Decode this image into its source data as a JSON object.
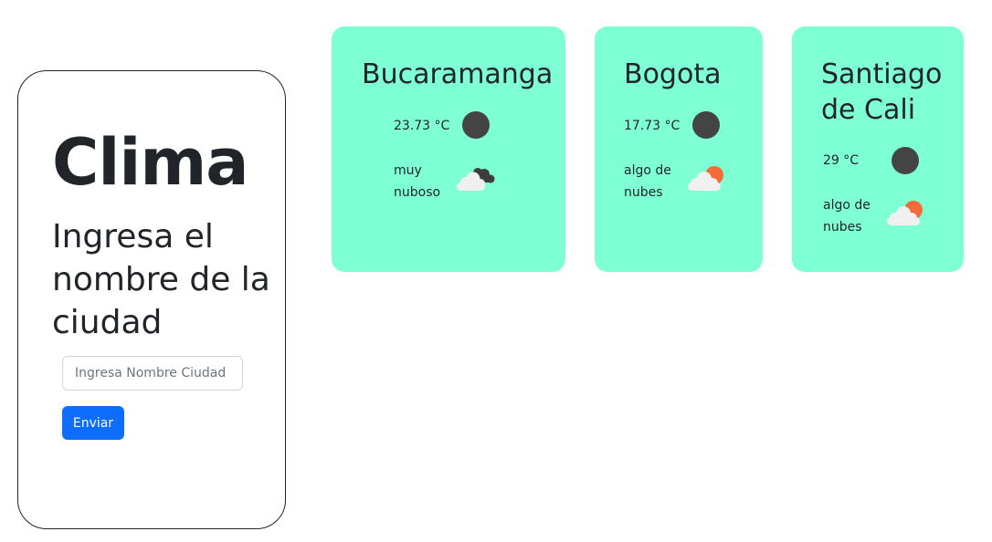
{
  "search": {
    "title": "Clima",
    "subtitle": "Ingresa el nombre de la ciudad",
    "input_placeholder": "Ingresa Nombre Ciudad",
    "input_value": "",
    "button_label": "Enviar"
  },
  "cards": [
    {
      "city": "Bucaramanga",
      "temperature": "23.73 °C",
      "description": "muy nuboso",
      "icon": "broken-clouds-icon"
    },
    {
      "city": "Bogota",
      "temperature": "17.73 °C",
      "description": "algo de nubes",
      "icon": "few-clouds-icon"
    },
    {
      "city": "Santiago de Cali",
      "temperature": "29 °C",
      "description": "algo de nubes",
      "icon": "few-clouds-icon"
    }
  ],
  "colors": {
    "card_background": "#7fffd4",
    "button_primary": "#0d6efd",
    "text": "#212529",
    "sun": "#f26b3a"
  }
}
